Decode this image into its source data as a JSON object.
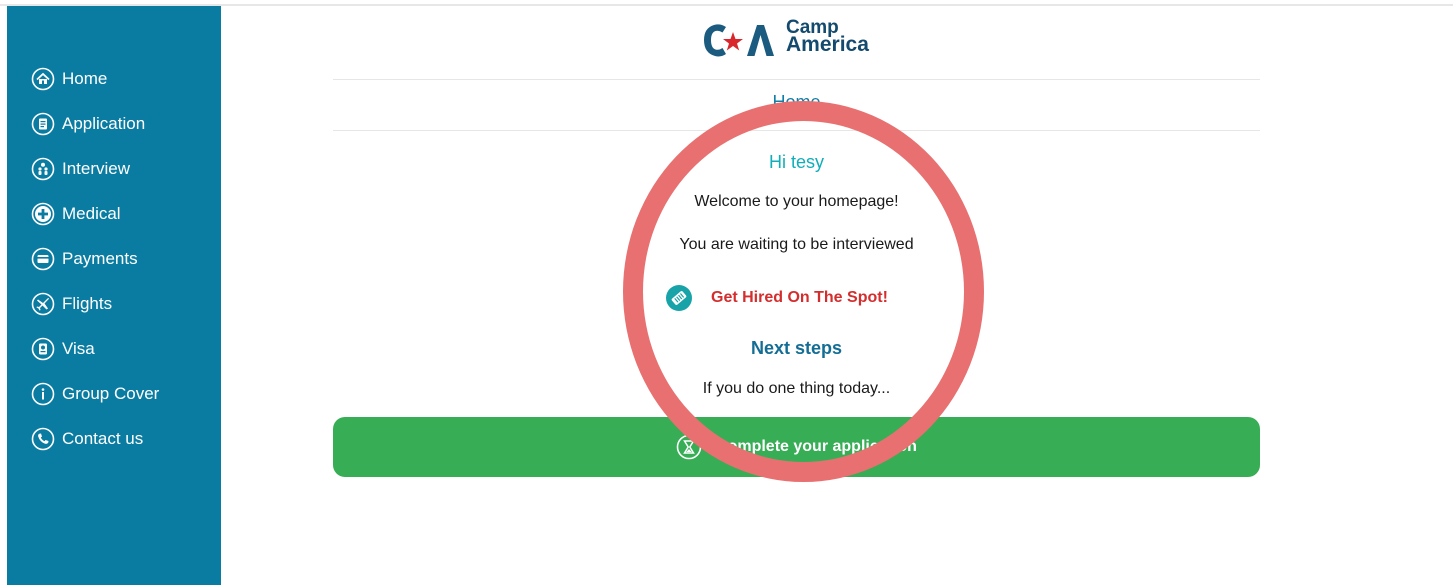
{
  "brand": {
    "logo_line1": "Camp",
    "logo_line2": "America",
    "logo_mark_color": "#1a5b7f",
    "logo_star_color": "#d9272e"
  },
  "sidebar": {
    "bg_color": "#0a7ca2",
    "items": [
      {
        "label": "Home",
        "icon": "home-icon"
      },
      {
        "label": "Application",
        "icon": "document-icon"
      },
      {
        "label": "Interview",
        "icon": "people-icon"
      },
      {
        "label": "Medical",
        "icon": "plus-icon"
      },
      {
        "label": "Payments",
        "icon": "credit-card-icon"
      },
      {
        "label": "Flights",
        "icon": "airplane-icon"
      },
      {
        "label": "Visa",
        "icon": "passport-icon"
      },
      {
        "label": "Group Cover",
        "icon": "info-icon"
      },
      {
        "label": "Contact us",
        "icon": "phone-icon"
      }
    ]
  },
  "main": {
    "page_title": "Home",
    "greeting": "Hi tesy",
    "welcome": "Welcome to your homepage!",
    "status": "You are waiting to be interviewed",
    "hired_link": "Get Hired On The Spot!",
    "next_steps_heading": "Next steps",
    "next_steps_text": "If you do one thing today...",
    "cta_label": "Complete your application",
    "cta_color": "#37ad55",
    "hired_color": "#d42d2d"
  },
  "annotation": {
    "ring_color": "#e87070"
  }
}
